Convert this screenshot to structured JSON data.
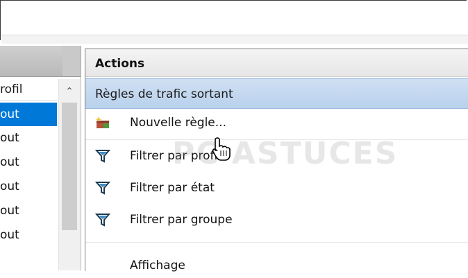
{
  "left_panel": {
    "column_header": "rofil",
    "rows": [
      {
        "label": "out",
        "selected": true
      },
      {
        "label": "out",
        "selected": false
      },
      {
        "label": "out",
        "selected": false
      },
      {
        "label": "out",
        "selected": false
      },
      {
        "label": "out",
        "selected": false
      },
      {
        "label": "out",
        "selected": false
      }
    ],
    "scroll_up_icon": "chevron-up-icon"
  },
  "actions_panel": {
    "title": "Actions",
    "section": "Règles de trafic sortant",
    "items": [
      {
        "label": "Nouvelle règle...",
        "icon": "new-rule-icon"
      },
      {
        "label": "Filtrer par profil",
        "icon": "filter-icon"
      },
      {
        "label": "Filtrer par état",
        "icon": "filter-icon"
      },
      {
        "label": "Filtrer par groupe",
        "icon": "filter-icon"
      },
      {
        "label": "Affichage",
        "icon": ""
      }
    ]
  },
  "watermark": "PC ASTUCES",
  "colors": {
    "selection": "#0078d7",
    "section_bg": "#c4d9f0",
    "header_bg": "#ececec"
  }
}
